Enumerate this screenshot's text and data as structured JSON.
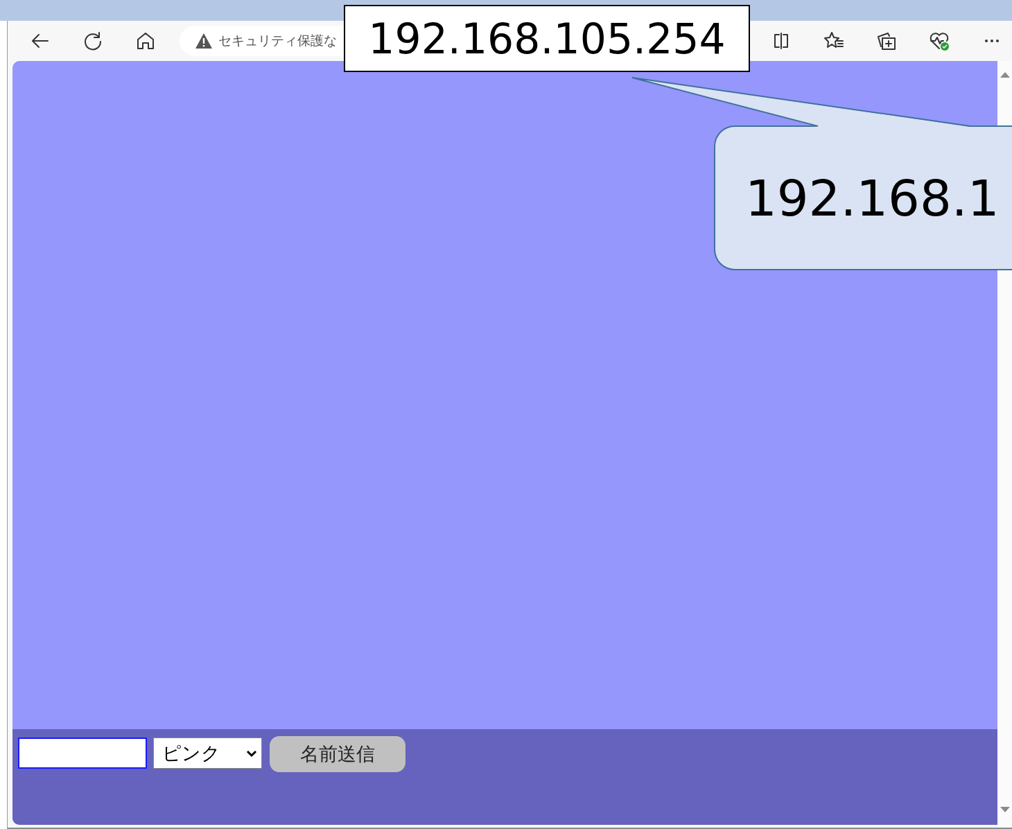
{
  "toolbar": {
    "address": "セキュリティ保護な"
  },
  "form": {
    "name_field": {
      "focused": true
    },
    "color_select": {
      "value": "ピンク"
    },
    "submit_button": {
      "label": "名前送信"
    }
  },
  "annotation_label": {
    "text": "192.168.105.254"
  },
  "callout": {
    "text": "192.168.1"
  }
}
